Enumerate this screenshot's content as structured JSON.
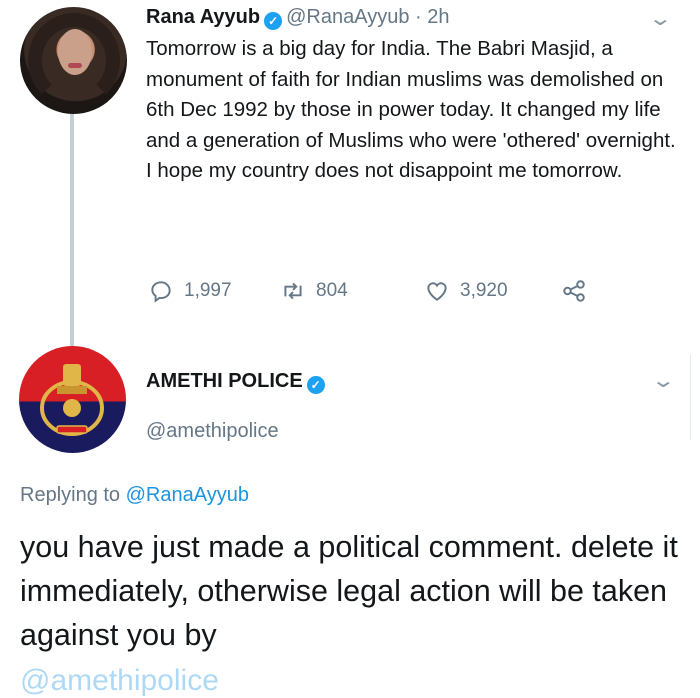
{
  "tweet1": {
    "name": "Rana Ayyub",
    "handle": "@RanaAyyub",
    "time": "· 2h",
    "text": "Tomorrow is a big day for India. The Babri Masjid, a monument of faith for Indian muslims was demolished on 6th Dec 1992 by those in power today. It changed my life and a generation of Muslims who were 'othered' overnight. I hope my country does not disappoint me tomorrow.",
    "replies": "1,997",
    "retweets": "804",
    "likes": "3,920"
  },
  "tweet2": {
    "name": "AMETHI POLICE",
    "handle": "@amethipolice",
    "replying_prefix": "Replying to",
    "replying_to": "@RanaAyyub",
    "text": "you have just made a political comment. delete it immediately, otherwise legal action will be taken against you by",
    "cutoff_text": "@amethipolice"
  },
  "icons": {
    "verified": "verified-badge-icon",
    "more": "chevron-down-icon",
    "reply": "reply-icon",
    "retweet": "retweet-icon",
    "like": "heart-icon",
    "share": "share-icon"
  },
  "colors": {
    "accent": "#1da1f2",
    "muted": "#657786",
    "text": "#14171a"
  }
}
